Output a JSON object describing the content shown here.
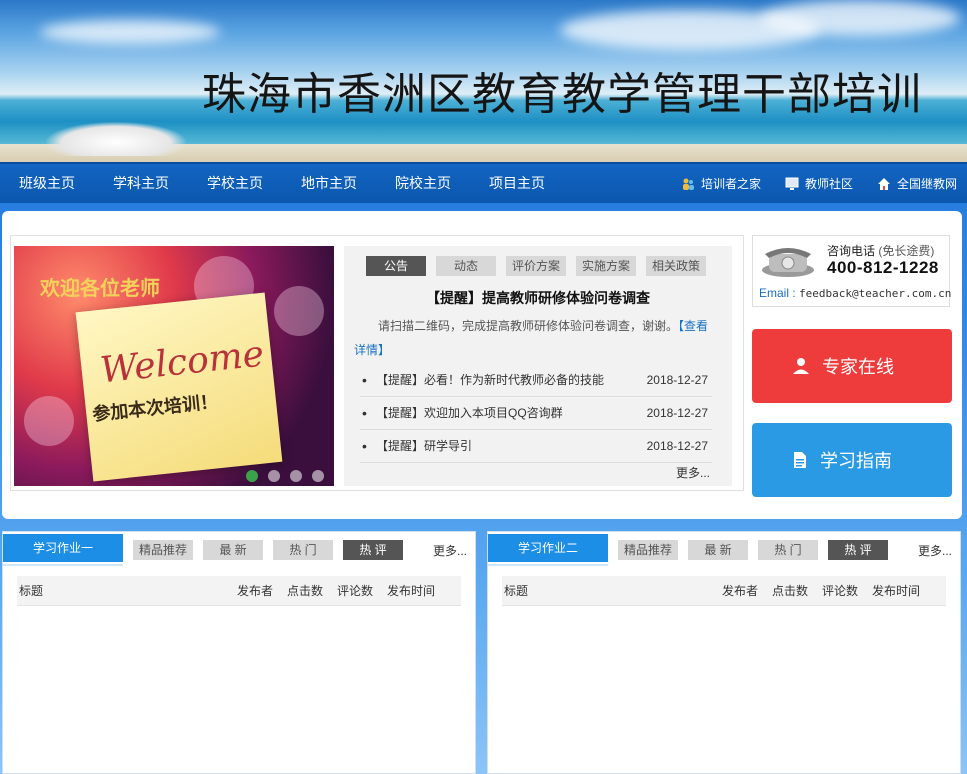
{
  "banner": {
    "title": "珠海市香洲区教育教学管理干部培训"
  },
  "nav": {
    "items": [
      {
        "label": "班级主页"
      },
      {
        "label": "学科主页"
      },
      {
        "label": "学校主页"
      },
      {
        "label": "地市主页"
      },
      {
        "label": "院校主页"
      },
      {
        "label": "项目主页"
      }
    ],
    "right": [
      {
        "label": "培训者之家",
        "icon": "people-icon"
      },
      {
        "label": "教师社区",
        "icon": "monitor-icon"
      },
      {
        "label": "全国继教网",
        "icon": "home-icon"
      }
    ]
  },
  "slide": {
    "line1": "欢迎各位老师",
    "line2": "Welcome",
    "line3": "参加本次培训！"
  },
  "notice": {
    "tabs": [
      "公告",
      "动态",
      "评价方案",
      "实施方案",
      "相关政策"
    ],
    "active_tab": "公告",
    "headline": "【提醒】提高教师研修体验问卷调查",
    "summary": "请扫描二维码，完成提高教师研修体验问卷调查，谢谢。",
    "summary_link": "【查看详情】",
    "items": [
      {
        "title": "【提醒】必看！作为新时代教师必备的技能",
        "date": "2018-12-27"
      },
      {
        "title": "【提醒】欢迎加入本项目QQ咨询群",
        "date": "2018-12-27"
      },
      {
        "title": "【提醒】研学导引",
        "date": "2018-12-27"
      }
    ],
    "more": "更多..."
  },
  "contact": {
    "label": "咨询电话",
    "label_sub": "(免长途费)",
    "phone": "400-812-1228",
    "email_label": "Email :",
    "email": "feedback@teacher.com.cn"
  },
  "buttons": {
    "expert": "专家在线",
    "guide": "学习指南"
  },
  "panels": [
    {
      "title": "学习作业一",
      "tabs": [
        "精品推荐",
        "最 新",
        "热 门",
        "热 评"
      ],
      "more": "更多...",
      "columns": [
        "标题",
        "发布者",
        "点击数",
        "评论数",
        "发布时间"
      ]
    },
    {
      "title": "学习作业二",
      "tabs": [
        "精品推荐",
        "最 新",
        "热 门",
        "热 评"
      ],
      "more": "更多...",
      "columns": [
        "标题",
        "发布者",
        "点击数",
        "评论数",
        "发布时间"
      ]
    }
  ],
  "colors": {
    "nav": "#0b57ae",
    "expert_button": "#ee3b3b",
    "guide_button": "#2b9ae4",
    "panel_tab": "#1c8ee6"
  }
}
